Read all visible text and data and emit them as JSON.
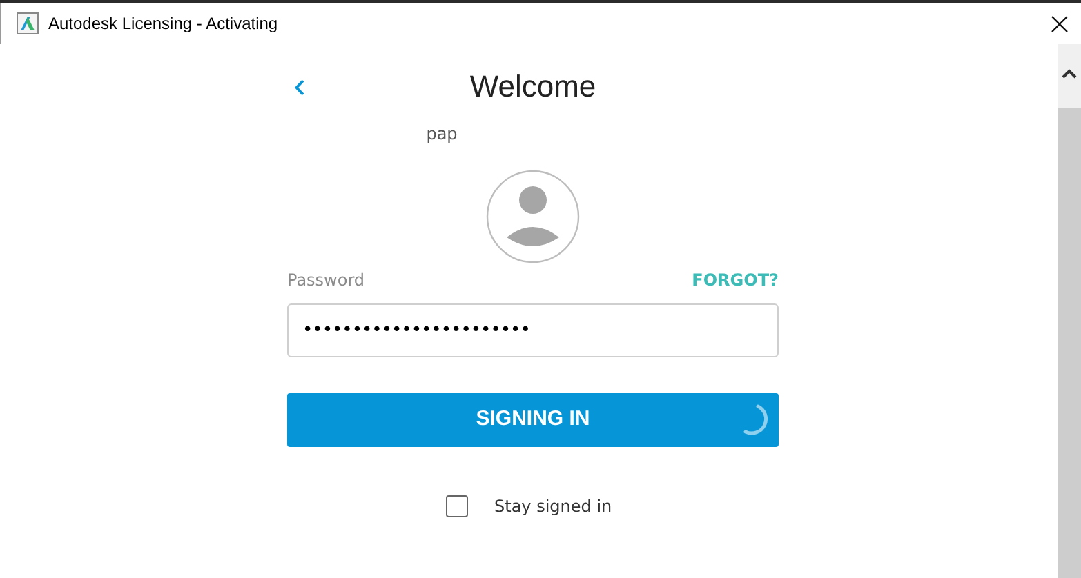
{
  "window": {
    "title": "Autodesk Licensing - Activating"
  },
  "heading": "Welcome",
  "account": "pap",
  "password": {
    "label": "Password",
    "value": "•••••••••••••••••••••••"
  },
  "forgot_link": "FORGOT?",
  "submit": {
    "label": "SIGNING IN",
    "loading": true
  },
  "stay_signed_in": {
    "label": "Stay signed in",
    "checked": false
  }
}
